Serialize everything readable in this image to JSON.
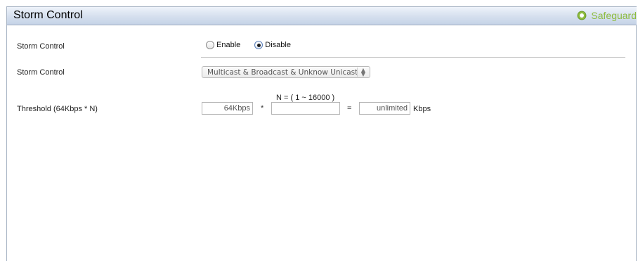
{
  "header": {
    "title": "Storm Control",
    "safeguard_label": "Safeguard",
    "safeguard_icon": "status-circle-icon",
    "safeguard_color": "#8dbb3e"
  },
  "storm_control_state": {
    "label": "Storm Control",
    "options": [
      {
        "label": "Enable",
        "checked": false
      },
      {
        "label": "Disable",
        "checked": true
      }
    ]
  },
  "storm_control_type": {
    "label": "Storm Control",
    "selected": "Multicast & Broadcast & Unknow Unicast"
  },
  "threshold": {
    "label": "Threshold (64Kbps * N)",
    "range_hint": "N = ( 1 ~ 16000 )",
    "base_value": "64Kbps",
    "multiply_symbol": "*",
    "n_value": "",
    "equals_symbol": "=",
    "result_value": "unlimited",
    "unit": "Kbps"
  }
}
